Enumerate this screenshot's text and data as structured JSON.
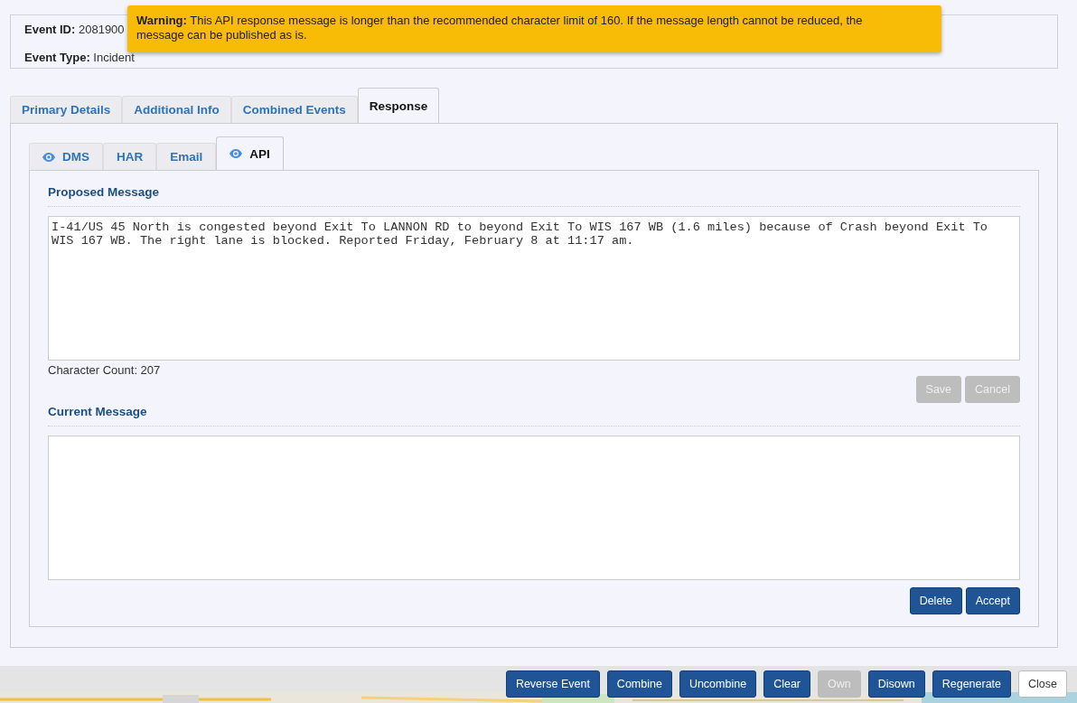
{
  "event_summary": {
    "fields": [
      {
        "label": "Event ID:",
        "value": "2081900"
      },
      {
        "label": "Event Type:",
        "value": "Incident"
      }
    ]
  },
  "warning": {
    "title": "Warning:",
    "message": "This API response message is longer than the recommended character limit of 160. If the message length cannot be reduced, the message can be published as is."
  },
  "tabs": [
    {
      "label": "Primary Details",
      "selected": false
    },
    {
      "label": "Additional Info",
      "selected": false
    },
    {
      "label": "Combined Events",
      "selected": false
    },
    {
      "label": "Response",
      "selected": true
    }
  ],
  "response_tabs": [
    {
      "label": "DMS",
      "selected": false,
      "previewed": true
    },
    {
      "label": "HAR",
      "selected": false,
      "previewed": false
    },
    {
      "label": "Email",
      "selected": false,
      "previewed": false
    },
    {
      "label": "API",
      "selected": true,
      "previewed": true
    }
  ],
  "proposed": {
    "heading": "Proposed Message",
    "value": "I-41/US 45 North is congested beyond Exit To LANNON RD to beyond Exit To WIS 167 WB (1.6 miles) because of Crash beyond Exit To WIS 167 WB. The right lane is blocked. Reported Friday, February 8 at 11:17 am.",
    "count": "Character Count: 207",
    "buttons": [
      {
        "label": "Save",
        "disabled": true
      },
      {
        "label": "Cancel",
        "disabled": true
      }
    ]
  },
  "current": {
    "heading": "Current Message",
    "buttons": [
      {
        "label": "Delete",
        "disabled": false
      },
      {
        "label": "Accept",
        "disabled": false
      }
    ]
  },
  "footer_buttons": [
    {
      "label": "Reverse Event",
      "kind": "primary",
      "disabled": false
    },
    {
      "label": "Combine",
      "kind": "primary",
      "disabled": false
    },
    {
      "label": "Uncombine",
      "kind": "primary",
      "disabled": false
    },
    {
      "label": "Clear",
      "kind": "primary",
      "disabled": false
    },
    {
      "label": "Own",
      "kind": "primary",
      "disabled": true
    },
    {
      "label": "Disown",
      "kind": "primary",
      "disabled": false
    },
    {
      "label": "Regenerate",
      "kind": "primary",
      "disabled": false
    },
    {
      "label": "Close",
      "kind": "default",
      "disabled": false
    }
  ]
}
